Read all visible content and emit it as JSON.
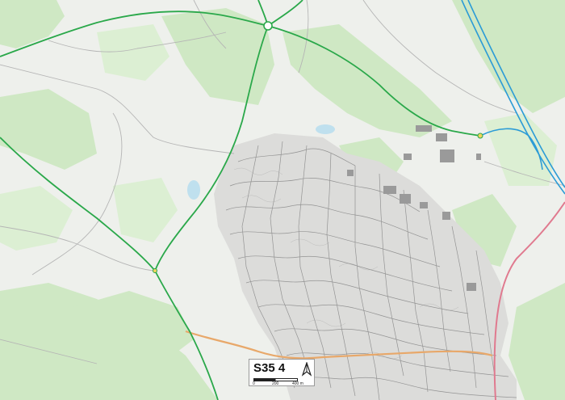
{
  "map": {
    "title": "S35 4",
    "scale": {
      "tick_0": "0",
      "tick_mid": "200",
      "tick_end": "400 m"
    },
    "north_label": "N",
    "colors": {
      "background": "#eef0ec",
      "woodland": "#cfe8c4",
      "woodland_light": "#dcefd3",
      "urban_fill": "#dcdcda",
      "street_line": "#8c8c8c",
      "major_road_green": "#2aa84a",
      "motorway_blue": "#2b9bd6",
      "a_road_orange": "#e8a86a",
      "railway_pink": "#e07a8f",
      "water": "#bfe0ee",
      "building": "#9a9a9a"
    }
  }
}
